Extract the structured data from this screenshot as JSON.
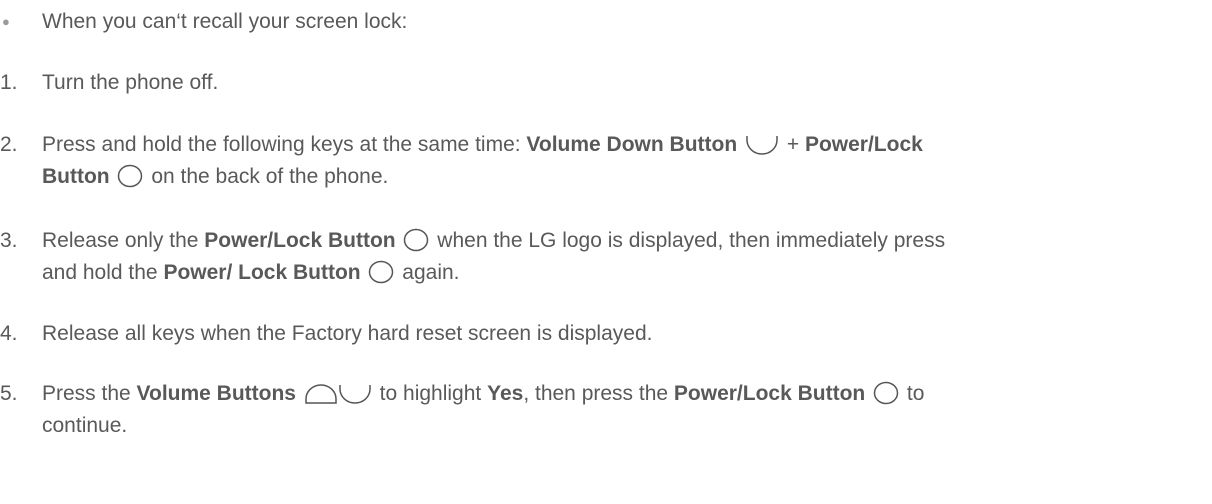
{
  "bullet_item": {
    "marker": "●",
    "text": "When you can‘t recall your screen lock:"
  },
  "steps": [
    {
      "number": "1.",
      "text": "Turn the phone off."
    },
    {
      "number": "2.",
      "t1": "Press and hold the following keys at the same time: ",
      "b1": "Volume Down Button",
      "t2": " + ",
      "b2": "Power/Lock",
      "b3": "Button",
      "t3": " on the back of the phone."
    },
    {
      "number": "3.",
      "t1": "Release only the ",
      "b1": "Power/Lock Button",
      "t2": " when the LG logo is displayed, then immediately press",
      "t3": "and hold the ",
      "b2": "Power/ Lock Button",
      "t4": " again."
    },
    {
      "number": "4.",
      "text": "Release all keys when the Factory hard reset screen is displayed."
    },
    {
      "number": "5.",
      "t1": "Press the ",
      "b1": "Volume Buttons",
      "t2": " to highlight ",
      "b2": "Yes",
      "t3": ", then press the ",
      "b3": "Power/Lock Button",
      "t4": " to",
      "t5": "continue."
    }
  ],
  "icons": {
    "volume_down": "volume-down-button-icon",
    "volume_up": "volume-up-button-icon",
    "power_lock": "power-lock-button-icon",
    "outline_color": "#555555",
    "fill_color": "#ffffff",
    "text_color": "#595959",
    "bullet_color": "#9a9a9a"
  }
}
